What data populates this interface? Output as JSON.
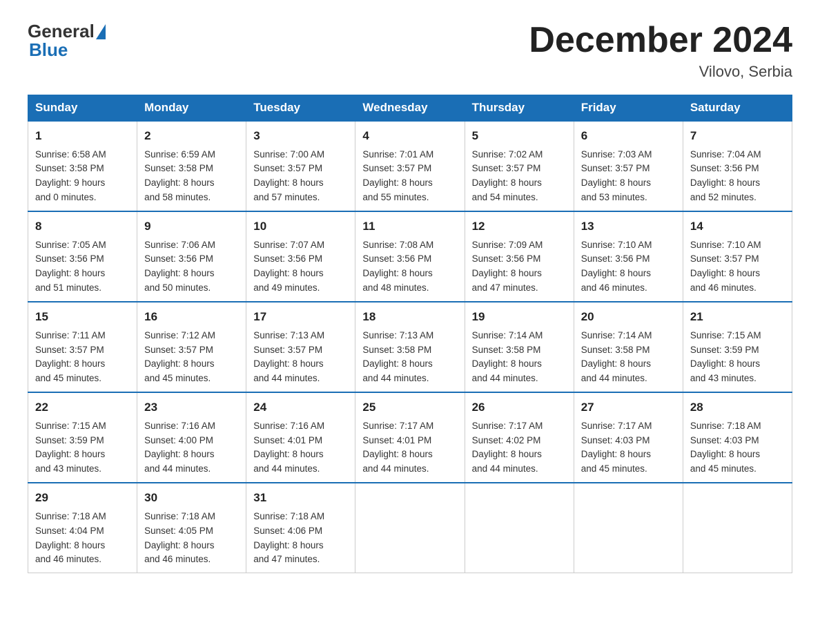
{
  "header": {
    "logo_general": "General",
    "logo_blue": "Blue",
    "month_title": "December 2024",
    "location": "Vilovo, Serbia"
  },
  "days_of_week": [
    "Sunday",
    "Monday",
    "Tuesday",
    "Wednesday",
    "Thursday",
    "Friday",
    "Saturday"
  ],
  "weeks": [
    [
      {
        "day": "1",
        "sunrise": "6:58 AM",
        "sunset": "3:58 PM",
        "daylight": "9 hours and 0 minutes."
      },
      {
        "day": "2",
        "sunrise": "6:59 AM",
        "sunset": "3:58 PM",
        "daylight": "8 hours and 58 minutes."
      },
      {
        "day": "3",
        "sunrise": "7:00 AM",
        "sunset": "3:57 PM",
        "daylight": "8 hours and 57 minutes."
      },
      {
        "day": "4",
        "sunrise": "7:01 AM",
        "sunset": "3:57 PM",
        "daylight": "8 hours and 55 minutes."
      },
      {
        "day": "5",
        "sunrise": "7:02 AM",
        "sunset": "3:57 PM",
        "daylight": "8 hours and 54 minutes."
      },
      {
        "day": "6",
        "sunrise": "7:03 AM",
        "sunset": "3:57 PM",
        "daylight": "8 hours and 53 minutes."
      },
      {
        "day": "7",
        "sunrise": "7:04 AM",
        "sunset": "3:56 PM",
        "daylight": "8 hours and 52 minutes."
      }
    ],
    [
      {
        "day": "8",
        "sunrise": "7:05 AM",
        "sunset": "3:56 PM",
        "daylight": "8 hours and 51 minutes."
      },
      {
        "day": "9",
        "sunrise": "7:06 AM",
        "sunset": "3:56 PM",
        "daylight": "8 hours and 50 minutes."
      },
      {
        "day": "10",
        "sunrise": "7:07 AM",
        "sunset": "3:56 PM",
        "daylight": "8 hours and 49 minutes."
      },
      {
        "day": "11",
        "sunrise": "7:08 AM",
        "sunset": "3:56 PM",
        "daylight": "8 hours and 48 minutes."
      },
      {
        "day": "12",
        "sunrise": "7:09 AM",
        "sunset": "3:56 PM",
        "daylight": "8 hours and 47 minutes."
      },
      {
        "day": "13",
        "sunrise": "7:10 AM",
        "sunset": "3:56 PM",
        "daylight": "8 hours and 46 minutes."
      },
      {
        "day": "14",
        "sunrise": "7:10 AM",
        "sunset": "3:57 PM",
        "daylight": "8 hours and 46 minutes."
      }
    ],
    [
      {
        "day": "15",
        "sunrise": "7:11 AM",
        "sunset": "3:57 PM",
        "daylight": "8 hours and 45 minutes."
      },
      {
        "day": "16",
        "sunrise": "7:12 AM",
        "sunset": "3:57 PM",
        "daylight": "8 hours and 45 minutes."
      },
      {
        "day": "17",
        "sunrise": "7:13 AM",
        "sunset": "3:57 PM",
        "daylight": "8 hours and 44 minutes."
      },
      {
        "day": "18",
        "sunrise": "7:13 AM",
        "sunset": "3:58 PM",
        "daylight": "8 hours and 44 minutes."
      },
      {
        "day": "19",
        "sunrise": "7:14 AM",
        "sunset": "3:58 PM",
        "daylight": "8 hours and 44 minutes."
      },
      {
        "day": "20",
        "sunrise": "7:14 AM",
        "sunset": "3:58 PM",
        "daylight": "8 hours and 44 minutes."
      },
      {
        "day": "21",
        "sunrise": "7:15 AM",
        "sunset": "3:59 PM",
        "daylight": "8 hours and 43 minutes."
      }
    ],
    [
      {
        "day": "22",
        "sunrise": "7:15 AM",
        "sunset": "3:59 PM",
        "daylight": "8 hours and 43 minutes."
      },
      {
        "day": "23",
        "sunrise": "7:16 AM",
        "sunset": "4:00 PM",
        "daylight": "8 hours and 44 minutes."
      },
      {
        "day": "24",
        "sunrise": "7:16 AM",
        "sunset": "4:01 PM",
        "daylight": "8 hours and 44 minutes."
      },
      {
        "day": "25",
        "sunrise": "7:17 AM",
        "sunset": "4:01 PM",
        "daylight": "8 hours and 44 minutes."
      },
      {
        "day": "26",
        "sunrise": "7:17 AM",
        "sunset": "4:02 PM",
        "daylight": "8 hours and 44 minutes."
      },
      {
        "day": "27",
        "sunrise": "7:17 AM",
        "sunset": "4:03 PM",
        "daylight": "8 hours and 45 minutes."
      },
      {
        "day": "28",
        "sunrise": "7:18 AM",
        "sunset": "4:03 PM",
        "daylight": "8 hours and 45 minutes."
      }
    ],
    [
      {
        "day": "29",
        "sunrise": "7:18 AM",
        "sunset": "4:04 PM",
        "daylight": "8 hours and 46 minutes."
      },
      {
        "day": "30",
        "sunrise": "7:18 AM",
        "sunset": "4:05 PM",
        "daylight": "8 hours and 46 minutes."
      },
      {
        "day": "31",
        "sunrise": "7:18 AM",
        "sunset": "4:06 PM",
        "daylight": "8 hours and 47 minutes."
      },
      null,
      null,
      null,
      null
    ]
  ]
}
